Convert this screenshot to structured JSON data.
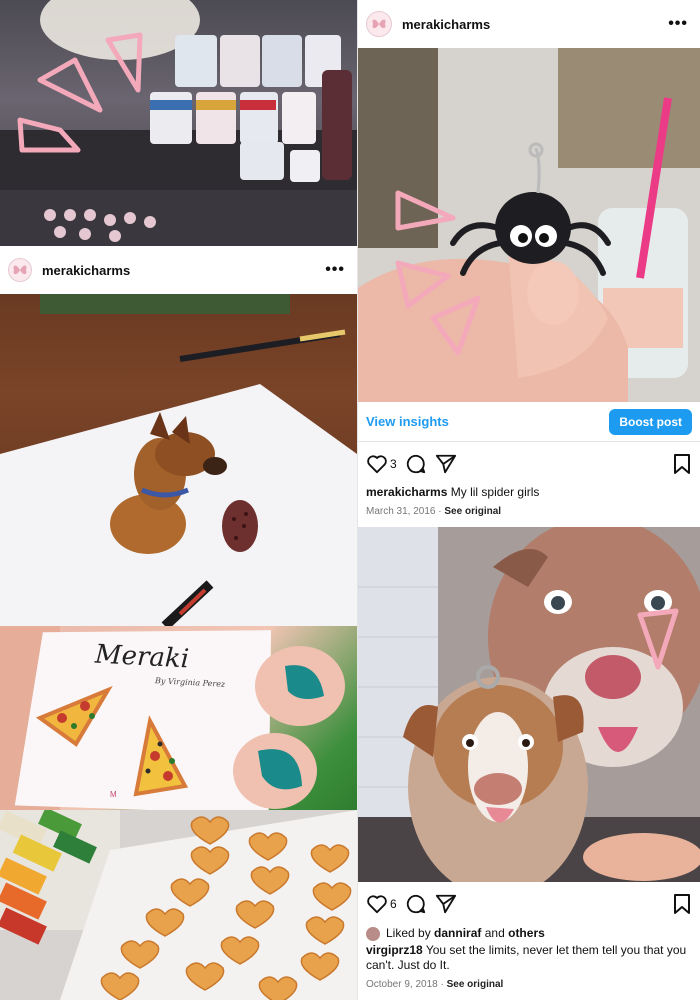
{
  "posts": [
    {
      "username": "merakicharms",
      "menu_icon": "more-icon",
      "photo": "clay dog figurine with a tiny clog on white paper"
    },
    {
      "username": "merakicharms",
      "menu_icon": "more-icon",
      "insights_label": "View insights",
      "boost_label": "Boost post",
      "likes": "3",
      "caption_user": "merakicharms",
      "caption_text": "My lil spider girls",
      "date": "March 31, 2016",
      "see_original": "See original"
    },
    {
      "likes": "6",
      "liked_by_prefix": "Liked by",
      "liked_by_user": "danniraf",
      "liked_by_and": "and",
      "liked_by_others": "others",
      "caption_user": "virgiprz18",
      "caption_text": "You set the limits, never let them tell you that you can't. Just do It.",
      "date": "October 9, 2018",
      "see_original": "See original"
    }
  ],
  "card": {
    "brand": "Meraki",
    "tagline": "By Virginia Perez"
  },
  "colors": {
    "accent": "#1d9bf0",
    "doodle": "#f4a9ba"
  }
}
